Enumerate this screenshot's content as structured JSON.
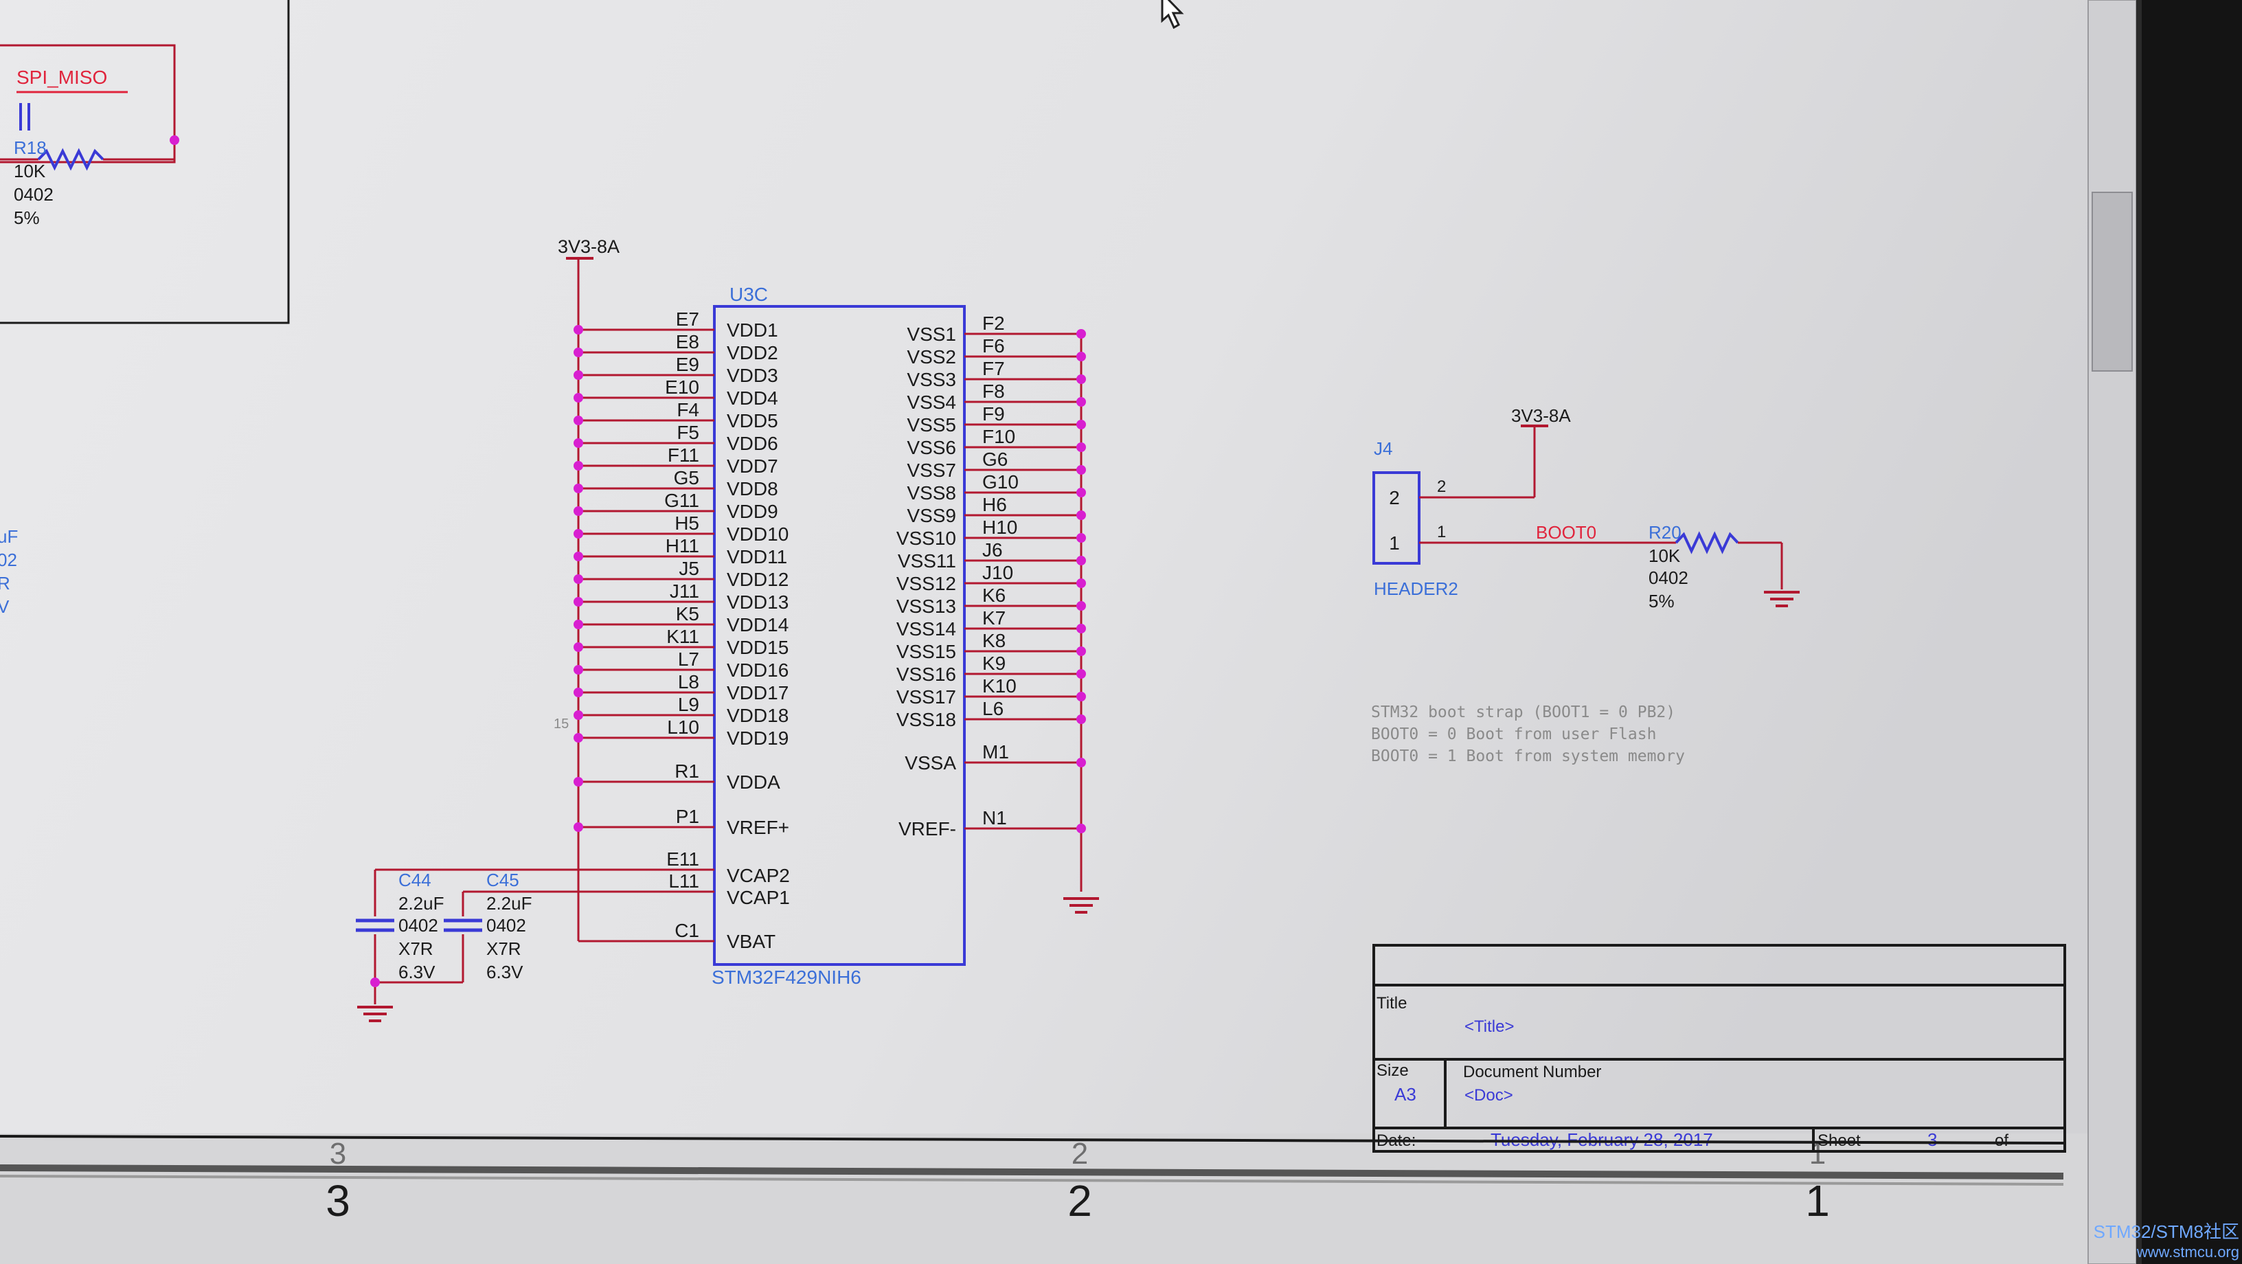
{
  "colors": {
    "paper": "#e4e4e6",
    "wire": "#b21830",
    "part": "#3a3ad6",
    "pinlabel": "#1b1b1b",
    "refdes": "#3b6fd8",
    "netlabel": "#e0243c",
    "junction": "#d81fd0",
    "note": "#8a8a8a",
    "frame": "#1a1a1a",
    "bezel": "#151515"
  },
  "top_left_block": {
    "net_label": "SPI_MISO",
    "resistor": {
      "ref": "R18",
      "value": "10K",
      "package": "0402",
      "tolerance": "5%"
    }
  },
  "left_edge_fragments": [
    "uF",
    "02",
    "R",
    "V"
  ],
  "power_label_main": "3V3-8A",
  "ic": {
    "ref": "U3C",
    "part_number": "STM32F429NIH6",
    "stray_number": "15",
    "left_pins": [
      {
        "ball": "E7",
        "name": "VDD1"
      },
      {
        "ball": "E8",
        "name": "VDD2"
      },
      {
        "ball": "E9",
        "name": "VDD3"
      },
      {
        "ball": "E10",
        "name": "VDD4"
      },
      {
        "ball": "F4",
        "name": "VDD5"
      },
      {
        "ball": "F5",
        "name": "VDD6"
      },
      {
        "ball": "F11",
        "name": "VDD7"
      },
      {
        "ball": "G5",
        "name": "VDD8"
      },
      {
        "ball": "G11",
        "name": "VDD9"
      },
      {
        "ball": "H5",
        "name": "VDD10"
      },
      {
        "ball": "H11",
        "name": "VDD11"
      },
      {
        "ball": "J5",
        "name": "VDD12"
      },
      {
        "ball": "J11",
        "name": "VDD13"
      },
      {
        "ball": "K5",
        "name": "VDD14"
      },
      {
        "ball": "K11",
        "name": "VDD15"
      },
      {
        "ball": "L7",
        "name": "VDD16"
      },
      {
        "ball": "L8",
        "name": "VDD17"
      },
      {
        "ball": "L9",
        "name": "VDD18"
      },
      {
        "ball": "L10",
        "name": "VDD19"
      }
    ],
    "vdda": {
      "ball": "R1",
      "name": "VDDA"
    },
    "vrefp": {
      "ball": "P1",
      "name": "VREF+"
    },
    "vcap2": {
      "ball": "E11",
      "name": "VCAP2"
    },
    "vcap1": {
      "ball": "L11",
      "name": "VCAP1"
    },
    "vbat": {
      "ball": "C1",
      "name": "VBAT"
    },
    "right_pins": [
      {
        "ball": "F2",
        "name": "VSS1"
      },
      {
        "ball": "F6",
        "name": "VSS2"
      },
      {
        "ball": "F7",
        "name": "VSS3"
      },
      {
        "ball": "F8",
        "name": "VSS4"
      },
      {
        "ball": "F9",
        "name": "VSS5"
      },
      {
        "ball": "F10",
        "name": "VSS6"
      },
      {
        "ball": "G6",
        "name": "VSS7"
      },
      {
        "ball": "G10",
        "name": "VSS8"
      },
      {
        "ball": "H6",
        "name": "VSS9"
      },
      {
        "ball": "H10",
        "name": "VSS10"
      },
      {
        "ball": "J6",
        "name": "VSS11"
      },
      {
        "ball": "J10",
        "name": "VSS12"
      },
      {
        "ball": "K6",
        "name": "VSS13"
      },
      {
        "ball": "K7",
        "name": "VSS14"
      },
      {
        "ball": "K8",
        "name": "VSS15"
      },
      {
        "ball": "K9",
        "name": "VSS16"
      },
      {
        "ball": "K10",
        "name": "VSS17"
      },
      {
        "ball": "L6",
        "name": "VSS18"
      }
    ],
    "vssa": {
      "ball": "M1",
      "name": "VSSA"
    },
    "vrefm": {
      "ball": "N1",
      "name": "VREF-"
    }
  },
  "capacitors": [
    {
      "ref": "C44",
      "value": "2.2uF",
      "package": "0402",
      "dielectric": "X7R",
      "voltage": "6.3V"
    },
    {
      "ref": "C45",
      "value": "2.2uF",
      "package": "0402",
      "dielectric": "X7R",
      "voltage": "6.3V"
    }
  ],
  "boot": {
    "header_ref": "J4",
    "header_name": "HEADER2",
    "pin2": "2",
    "pin1": "1",
    "power_label": "3V3-8A",
    "net_label": "BOOT0",
    "resistor": {
      "ref": "R20",
      "value": "10K",
      "package": "0402",
      "tolerance": "5%"
    }
  },
  "notes": [
    "STM32 boot strap (BOOT1 = 0 PB2)",
    "BOOT0 = 0 Boot from user Flash",
    "BOOT0 = 1 Boot from system memory"
  ],
  "title_block": {
    "title_label": "Title",
    "title_value": "<Title>",
    "size_label": "Size",
    "size_value": "A3",
    "docnum_label": "Document Number",
    "docnum_value": "<Doc>",
    "date_label": "Date:",
    "date_value": "Tuesday, February 28, 2017",
    "sheet_label": "Sheet",
    "sheet_value": "3",
    "of_label": "of"
  },
  "zone_numbers": [
    "3",
    "2",
    "1"
  ],
  "watermark": {
    "line1": "STM32/STM8社区",
    "line2": "www.stmcu.org"
  }
}
